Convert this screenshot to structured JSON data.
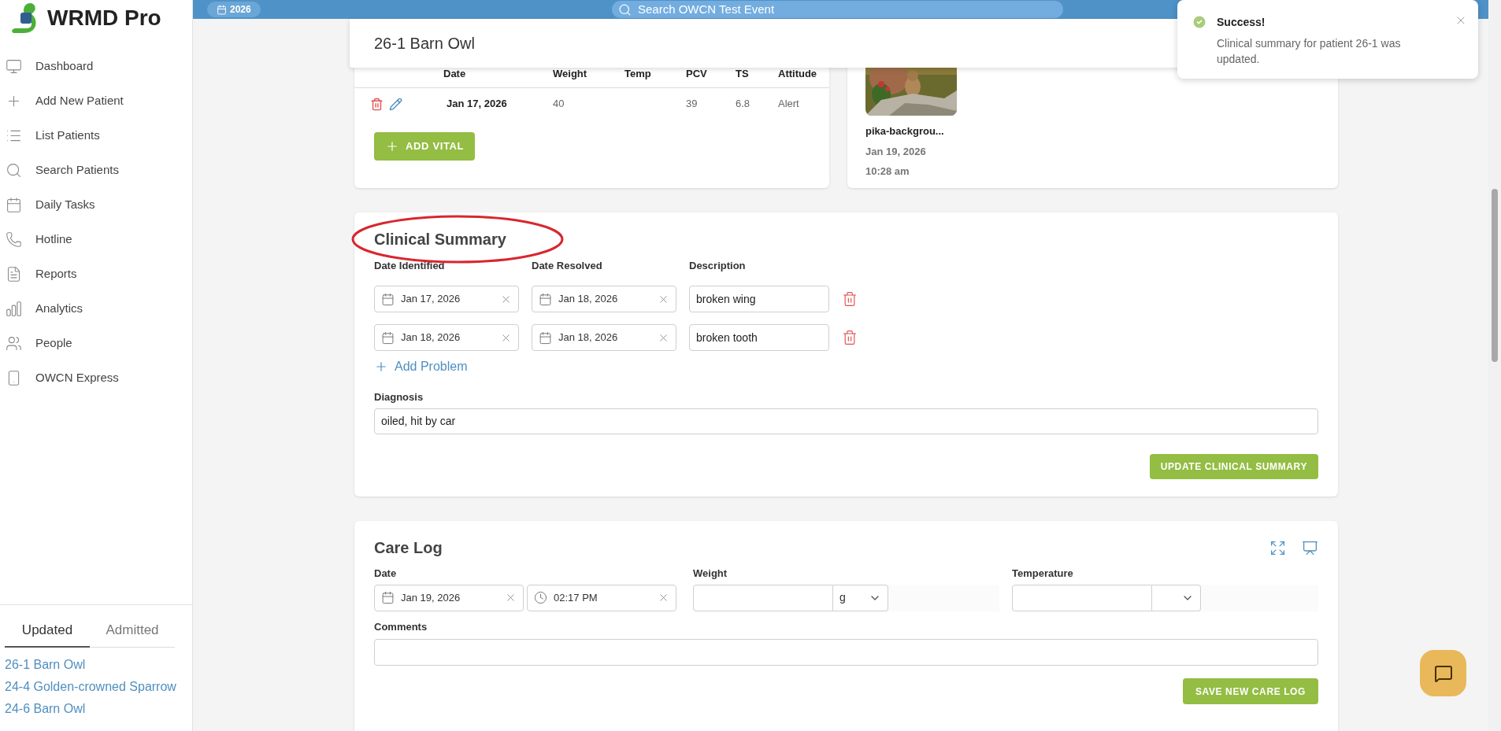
{
  "app": {
    "name": "WRMD Pro"
  },
  "top_bar": {
    "year": "2026",
    "search": {
      "placeholder": "Search OWCN Test Event"
    }
  },
  "sidebar": {
    "items": [
      {
        "label": "Dashboard"
      },
      {
        "label": "Add New Patient"
      },
      {
        "label": "List Patients"
      },
      {
        "label": "Search Patients"
      },
      {
        "label": "Daily Tasks"
      },
      {
        "label": "Hotline"
      },
      {
        "label": "Reports"
      },
      {
        "label": "Analytics"
      },
      {
        "label": "People"
      },
      {
        "label": "OWCN Express"
      }
    ]
  },
  "recent": {
    "tabs": [
      {
        "label": "Updated",
        "selected": true
      },
      {
        "label": "Admitted",
        "selected": false
      }
    ],
    "patients": [
      "26-1 Barn Owl",
      "24-4 Golden-crowned Sparrow",
      "24-6 Barn Owl"
    ]
  },
  "patient_header": {
    "title": "26-1 Barn Owl"
  },
  "vitals": {
    "columns": [
      "Date",
      "Weight",
      "Temp",
      "PCV",
      "TS",
      "Attitude"
    ],
    "rows": [
      {
        "date": "Jan 17, 2026",
        "weight": "40",
        "pcv": "39",
        "ts": "6.8",
        "attitude": "Alert"
      }
    ],
    "add_button": "ADD VITAL"
  },
  "evidence_photos": {
    "photos": [
      {
        "kind": "picture",
        "name": "pika-backgrou...",
        "date": "Jan 19, 2026",
        "time": "10:28 am"
      }
    ]
  },
  "clinical_summary": {
    "title": "Clinical Summary",
    "circled": true,
    "columns": [
      "Date Identified",
      "Date Resolved",
      "Description"
    ],
    "problems": [
      {
        "date_identified": "Jan 17, 2026",
        "date_resolved": "Jan 18, 2026",
        "description": "broken wing"
      },
      {
        "date_identified": "Jan 18, 2026",
        "date_resolved": "Jan 18, 2026",
        "description": "broken tooth"
      }
    ],
    "add_problem": "Add Problem",
    "diagnosis": {
      "label": "Diagnosis",
      "value": "oiled, hit by car"
    },
    "button": "UPDATE CLINICAL SUMMARY"
  },
  "care_log": {
    "title": "Care Log",
    "date_label": "Date",
    "date": "Jan 19, 2026",
    "time": "02:17 PM",
    "weight_label": "Weight",
    "weight_unit": "g",
    "temperature_label": "Temperature",
    "comments_label": "Comments",
    "button": "SAVE NEW CARE LOG"
  },
  "toast": {
    "title": "Success!",
    "message": "Clinical summary for patient 26-1 was updated."
  }
}
